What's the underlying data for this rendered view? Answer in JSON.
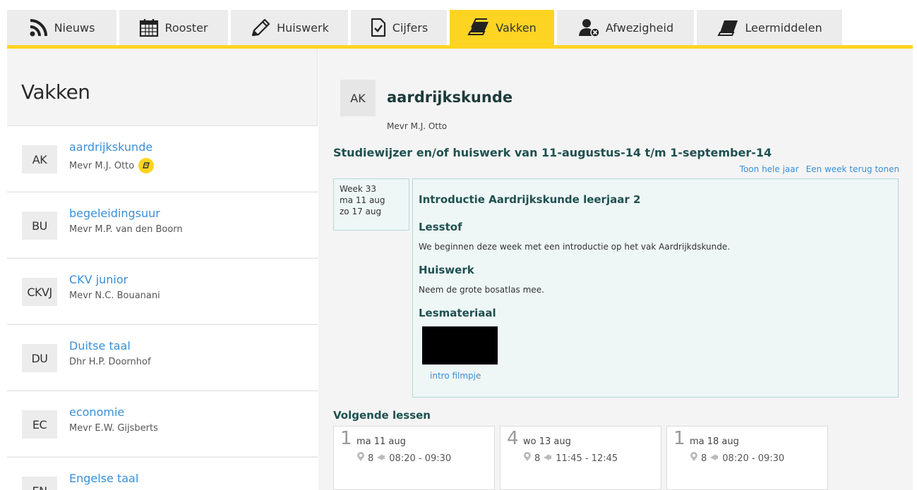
{
  "tabs": [
    {
      "label": "Nieuws",
      "icon": "rss-icon",
      "active": false
    },
    {
      "label": "Rooster",
      "icon": "calendar-icon",
      "active": false
    },
    {
      "label": "Huiswerk",
      "icon": "pencil-icon",
      "active": false
    },
    {
      "label": "Cijfers",
      "icon": "checkmark-document-icon",
      "active": false
    },
    {
      "label": "Vakken",
      "icon": "books-icon",
      "active": true
    },
    {
      "label": "Afwezigheid",
      "icon": "user-absent-icon",
      "active": false
    },
    {
      "label": "Leermiddelen",
      "icon": "book-icon",
      "active": false
    }
  ],
  "colors": {
    "accent": "#fdd422",
    "link": "#3a8fd8",
    "heading": "#1f5050"
  },
  "sidebar": {
    "title": "Vakken",
    "items": [
      {
        "abbr": "AK",
        "name": "aardrijkskunde",
        "teacher": "Mevr M.J. Otto",
        "badge": true,
        "selected": true
      },
      {
        "abbr": "BU",
        "name": "begeleidingsuur",
        "teacher": "Mevr M.P. van den Boorn",
        "badge": false
      },
      {
        "abbr": "CKVJ",
        "name": "CKV junior",
        "teacher": "Mevr N.C. Bouanani",
        "badge": false
      },
      {
        "abbr": "DU",
        "name": "Duitse taal",
        "teacher": "Dhr H.P. Doornhof",
        "badge": false
      },
      {
        "abbr": "EC",
        "name": "economie",
        "teacher": "Mevr E.W. Gijsberts",
        "badge": false
      },
      {
        "abbr": "EN",
        "name": "Engelse taal",
        "teacher": "",
        "badge": false
      }
    ]
  },
  "main": {
    "abbr": "AK",
    "vak": "aardrijkskunde",
    "docent": "Mevr M.J. Otto",
    "studiewijzer_title": "Studiewijzer en/of huiswerk van 11-augustus-14 t/m 1-september-14",
    "link_whole_year": "Toon hele jaar",
    "link_week_back": "Een week terug tonen",
    "week": {
      "label": "Week 33",
      "start": "ma 11 aug",
      "end": "zo 17 aug"
    },
    "entry": {
      "title": "Introductie Aardrijkskunde leerjaar 2",
      "lesstof_heading": "Lesstof",
      "lesstof_text": "We beginnen deze week met een introductie op het vak Aardrijkdskunde.",
      "huiswerk_heading": "Huiswerk",
      "huiswerk_text": "Neem de grote bosatlas mee.",
      "lesmateriaal_heading": "Lesmateriaal",
      "lesmateriaal_caption": "intro filmpje"
    },
    "volgende_heading": "Volgende lessen",
    "lessons": [
      {
        "hour": "1",
        "date": "ma 11 aug",
        "room": "8",
        "time": "08:20 - 09:30"
      },
      {
        "hour": "4",
        "date": "wo 13 aug",
        "room": "8",
        "time": "11:45 - 12:45"
      },
      {
        "hour": "1",
        "date": "ma 18 aug",
        "room": "8",
        "time": "08:20 - 09:30"
      }
    ]
  }
}
